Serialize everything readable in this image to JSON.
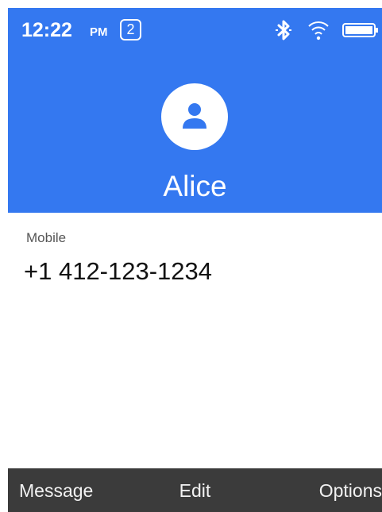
{
  "statusbar": {
    "time": "12:22",
    "ampm": "PM",
    "sim_slot": "2",
    "icons": [
      "bluetooth-icon",
      "wifi-icon",
      "battery-icon"
    ]
  },
  "contact": {
    "name": "Alice",
    "avatar_icon": "person-icon",
    "phone_label": "Mobile",
    "phone_number": "+1 412-123-1234"
  },
  "softkeys": {
    "left": "Message",
    "center": "Edit",
    "right": "Options"
  },
  "colors": {
    "header_bg": "#3478f0",
    "softkey_bg": "#3b3b3b"
  }
}
